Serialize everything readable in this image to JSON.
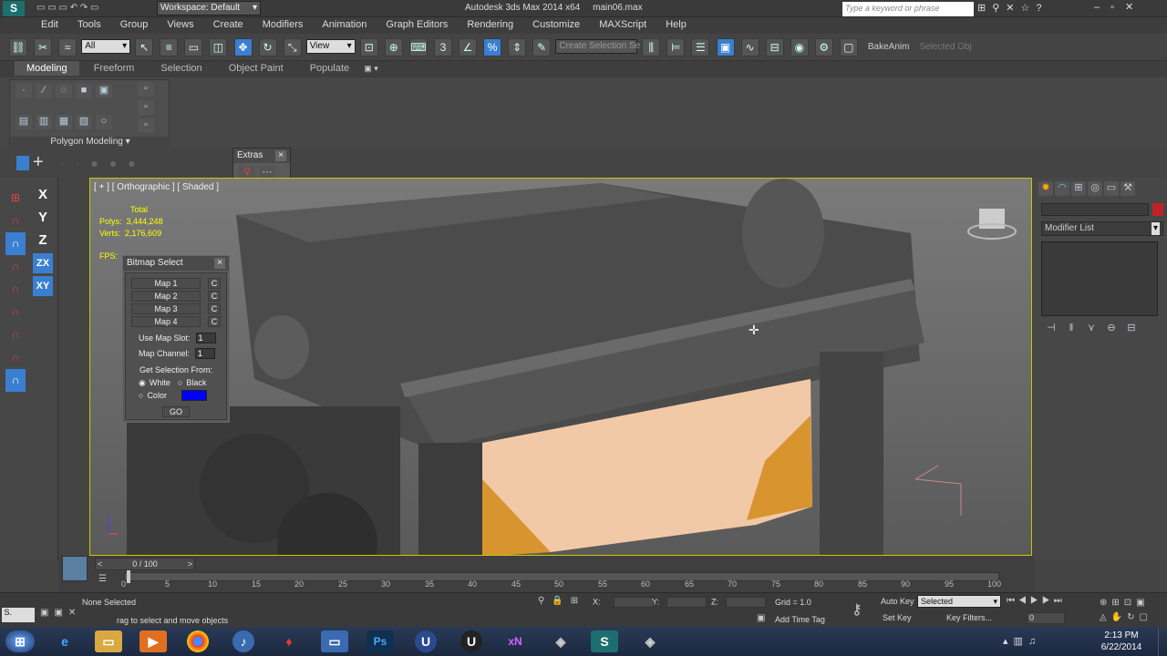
{
  "titlebar": {
    "workspace": "Workspace: Default",
    "app_title": "Autodesk 3ds Max 2014 x64",
    "file_name": "main06.max",
    "search_placeholder": "Type a keyword or phrase"
  },
  "menu": [
    "Edit",
    "Tools",
    "Group",
    "Views",
    "Create",
    "Modifiers",
    "Animation",
    "Graph Editors",
    "Rendering",
    "Customize",
    "MAXScript",
    "Help"
  ],
  "toolbar": {
    "selection_filter": "All",
    "ref_coord": "View",
    "named_selection_placeholder": "Create Selection Se",
    "bake_anim": "BakeAnim",
    "selected_obj": "Selected Obj"
  },
  "ribbon": {
    "tabs": [
      "Modeling",
      "Freeform",
      "Selection",
      "Object Paint",
      "Populate"
    ],
    "panel_label": "Polygon Modeling"
  },
  "extras": {
    "title": "Extras"
  },
  "viewport": {
    "label": "[ + ] [ Orthographic ] [ Shaded ]",
    "stats_total": "Total",
    "polys_label": "Polys:",
    "polys_value": "3,444,248",
    "verts_label": "Verts:",
    "verts_value": "2,176,609",
    "fps_label": "FPS:"
  },
  "axis_buttons": [
    "X",
    "Y",
    "Z",
    "ZX",
    "XY"
  ],
  "bitmap_select": {
    "title": "Bitmap Select",
    "maps": [
      "Map 1",
      "Map 2",
      "Map 3",
      "Map 4"
    ],
    "c_label": "C",
    "use_map_slot_label": "Use Map Slot:",
    "use_map_slot_value": "1",
    "map_channel_label": "Map Channel:",
    "map_channel_value": "1",
    "get_selection_label": "Get Selection From:",
    "white_label": "White",
    "black_label": "Black",
    "color_label": "Color",
    "swatch_color": "#0000ff",
    "go_label": "GO"
  },
  "command_panel": {
    "modifier_list": "Modifier List"
  },
  "timeline": {
    "frame_display": "0 / 100",
    "ticks": [
      "0",
      "5",
      "10",
      "15",
      "20",
      "25",
      "30",
      "35",
      "40",
      "45",
      "50",
      "55",
      "60",
      "65",
      "70",
      "75",
      "80",
      "85",
      "90",
      "95",
      "100"
    ]
  },
  "status": {
    "none_selected": "None Selected",
    "prompt": "rag to select and move objects",
    "x_label": "X:",
    "y_label": "Y:",
    "z_label": "Z:",
    "grid": "Grid = 1.0",
    "add_time_tag": "Add Time Tag",
    "auto_key": "Auto Key",
    "set_key": "Set Key",
    "key_mode": "Selected",
    "key_filters": "Key Filters...",
    "current_frame": "0"
  },
  "taskbar": {
    "time": "2:13 PM",
    "date": "6/22/2014"
  }
}
